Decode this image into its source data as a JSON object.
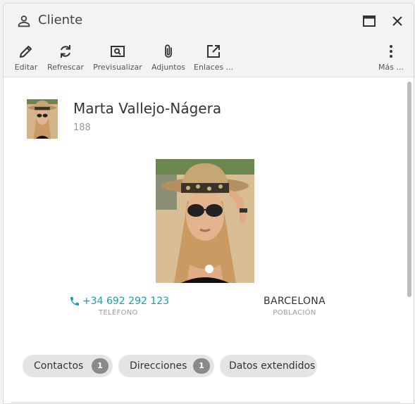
{
  "window": {
    "title": "Cliente",
    "icon": "person-icon"
  },
  "toolbar": {
    "edit": "Editar",
    "refresh": "Refrescar",
    "preview": "Previsualizar",
    "attachments": "Adjuntos",
    "links": "Enlaces ...",
    "more": "Más ..."
  },
  "record": {
    "name": "Marta Vallejo-Nágera",
    "code": "188",
    "phone": {
      "value": "+34 692 292 123",
      "label": "TELÉFONO"
    },
    "city": {
      "value": "BARCELONA",
      "label": "POBLACIÓN"
    }
  },
  "tabs": [
    {
      "label": "Contactos",
      "count": "1"
    },
    {
      "label": "Direcciones",
      "count": "1"
    },
    {
      "label": "Datos extendidos"
    }
  ],
  "colors": {
    "accent": "#1a9bb0",
    "badge": "#8a8a8a",
    "chip": "#e4e4e4"
  }
}
